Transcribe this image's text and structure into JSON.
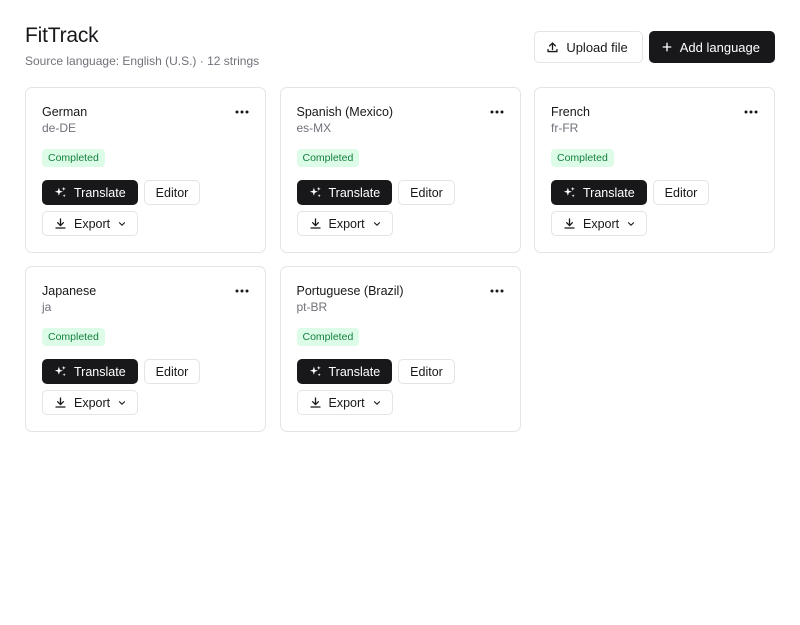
{
  "app": {
    "title": "FitTrack",
    "subtitle": "Source language: English (U.S.) · 12 strings"
  },
  "actions": {
    "upload_label": "Upload file",
    "add_language_label": "Add language"
  },
  "colors": {
    "primary": "#18181b",
    "badge_bg": "#dcfce7",
    "badge_text": "#15803d",
    "border": "#e4e4e7",
    "muted_text": "#71717a"
  },
  "languages": [
    {
      "name": "German",
      "code": "de-DE",
      "status": "Completed",
      "translate_label": "Translate",
      "editor_label": "Editor",
      "export_label": "Export"
    },
    {
      "name": "Spanish (Mexico)",
      "code": "es-MX",
      "status": "Completed",
      "translate_label": "Translate",
      "editor_label": "Editor",
      "export_label": "Export"
    },
    {
      "name": "French",
      "code": "fr-FR",
      "status": "Completed",
      "translate_label": "Translate",
      "editor_label": "Editor",
      "export_label": "Export"
    },
    {
      "name": "Japanese",
      "code": "ja",
      "status": "Completed",
      "translate_label": "Translate",
      "editor_label": "Editor",
      "export_label": "Export"
    },
    {
      "name": "Portuguese (Brazil)",
      "code": "pt-BR",
      "status": "Completed",
      "translate_label": "Translate",
      "editor_label": "Editor",
      "export_label": "Export"
    }
  ],
  "icons": {
    "upload": "upload-icon",
    "add": "plus-icon",
    "more": "more-horizontal-icon",
    "translate": "sparkles-icon",
    "export": "download-icon",
    "dropdown": "chevron-down-icon"
  }
}
